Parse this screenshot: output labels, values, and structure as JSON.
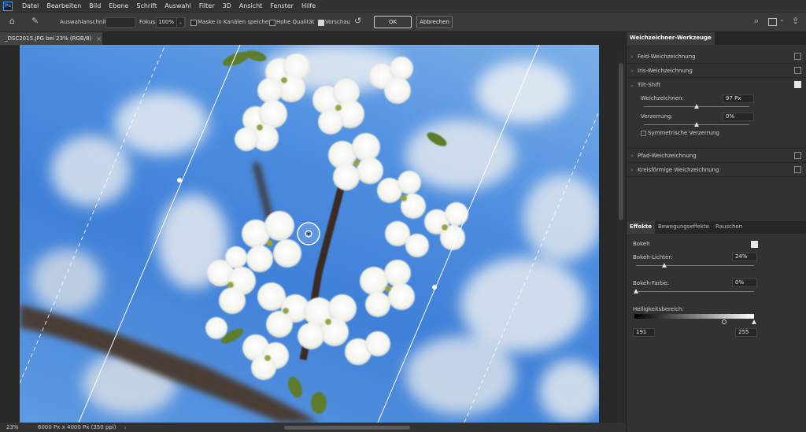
{
  "app": {
    "logo": "Ps"
  },
  "menu": [
    "Datei",
    "Bearbeiten",
    "Bild",
    "Ebene",
    "Schrift",
    "Auswahl",
    "Filter",
    "3D",
    "Ansicht",
    "Fenster",
    "Hilfe"
  ],
  "options": {
    "selection_label": "Auswahlanschnitt:",
    "focus_label": "Fokus:",
    "focus_value": "100%",
    "mask_label": "Maske in Kanälen speichern",
    "quality_label": "Hohe Qualität",
    "preview_label": "Vorschau",
    "ok_label": "OK",
    "cancel_label": "Abbrechen"
  },
  "document": {
    "tab_title": "_DSC2015.JPG bei 23% (RGB/8)",
    "close": "×"
  },
  "status": {
    "zoom": "23%",
    "info": "6000 Px x 4000 Px (350 ppi)",
    "arrow": "›"
  },
  "blur_tools": {
    "title": "Weichzeichner-Werkzeuge",
    "items": [
      {
        "label": "Feld-Weichzeichnung",
        "checked": false
      },
      {
        "label": "Iris-Weichzeichnung",
        "checked": false
      },
      {
        "label": "Tilt-Shift",
        "checked": true
      }
    ],
    "tiltshift": {
      "blur_label": "Weichzeichnen:",
      "blur_value": "97 Px",
      "distortion_label": "Verzerrung:",
      "distortion_value": "0%",
      "symmetric_label": "Symmetrische Verzerrung"
    },
    "more_items": [
      {
        "label": "Pfad-Weichzeichnung",
        "checked": false
      },
      {
        "label": "Kreisförmige Weichzeichnung",
        "checked": false
      }
    ]
  },
  "effects": {
    "tabs": [
      "Effekte",
      "Bewegungseffekte",
      "Rauschen"
    ],
    "bokeh_label": "Bokeh",
    "bokeh_lights_label": "Bokeh-Lichter:",
    "bokeh_lights_value": "24%",
    "bokeh_color_label": "Bokeh-Farbe:",
    "bokeh_color_value": "0%",
    "brightness_label": "Helligkeitsbereich:",
    "range_low": "191",
    "range_high": "255"
  },
  "colors": {
    "accent": "#31a8ff",
    "sky": "#4e8ee0"
  }
}
